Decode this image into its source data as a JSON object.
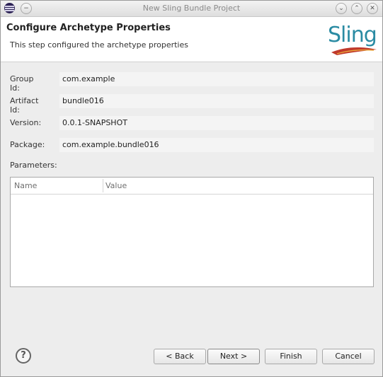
{
  "window": {
    "title": "New Sling Bundle Project",
    "icon": "eclipse-icon",
    "controls": [
      {
        "name": "minimize-icon",
        "glyph": "⌄"
      },
      {
        "name": "maximize-icon",
        "glyph": "⌃"
      },
      {
        "name": "close-icon",
        "glyph": "✕"
      }
    ],
    "menu_glyph": "−"
  },
  "header": {
    "title": "Configure Archetype Properties",
    "description": "This step configured the archetype properties",
    "logo_text": "Sling"
  },
  "form": {
    "group_id": {
      "label": "Group Id:",
      "value": "com.example"
    },
    "artifact_id": {
      "label": "Artifact Id:",
      "value": "bundle016"
    },
    "version": {
      "label": "Version:",
      "value": "0.0.1-SNAPSHOT"
    },
    "package": {
      "label": "Package:",
      "value": "com.example.bundle016"
    }
  },
  "parameters": {
    "label": "Parameters:",
    "columns": [
      "Name",
      "Value"
    ],
    "rows": []
  },
  "footer": {
    "help_glyph": "?",
    "back_label": "< Back",
    "next_label": "Next >",
    "finish_label": "Finish",
    "cancel_label": "Cancel"
  },
  "colors": {
    "logo": "#2a8ba3",
    "feather": "#c0392b"
  }
}
